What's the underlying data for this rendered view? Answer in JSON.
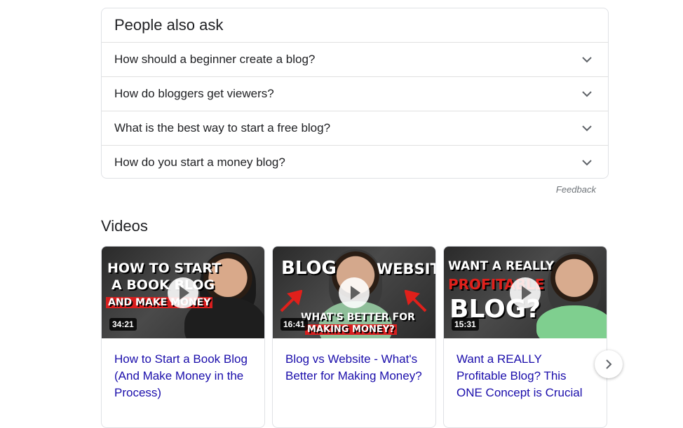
{
  "paa": {
    "title": "People also ask",
    "questions": [
      "How should a beginner create a blog?",
      "How do bloggers get viewers?",
      "What is the best way to start a free blog?",
      "How do you start a money blog?"
    ],
    "feedback": "Feedback"
  },
  "videos": {
    "title": "Videos",
    "items": [
      {
        "title": "How to Start a Book Blog (And Make Money in the Process)",
        "duration": "34:21",
        "thumb_lines": [
          "HOW TO START",
          "A BOOK BLOG",
          "AND MAKE MONEY"
        ]
      },
      {
        "title": "Blog vs Website - What's Better for Making Money?",
        "duration": "16:41",
        "thumb_lines": [
          "BLOG",
          "WEBSITE",
          "WHAT'S BETTER FOR",
          "MAKING MONEY?"
        ]
      },
      {
        "title": "Want a REALLY Profitable Blog? This ONE Concept is Crucial",
        "duration": "15:31",
        "thumb_lines": [
          "WANT A REALLY",
          "PROFITABLE",
          "BLOG?"
        ]
      }
    ],
    "next_icon": "chevron-right-icon"
  },
  "colors": {
    "link": "#1a0dab",
    "text": "#202124",
    "border": "#dfe1e5",
    "muted": "#70757a"
  }
}
